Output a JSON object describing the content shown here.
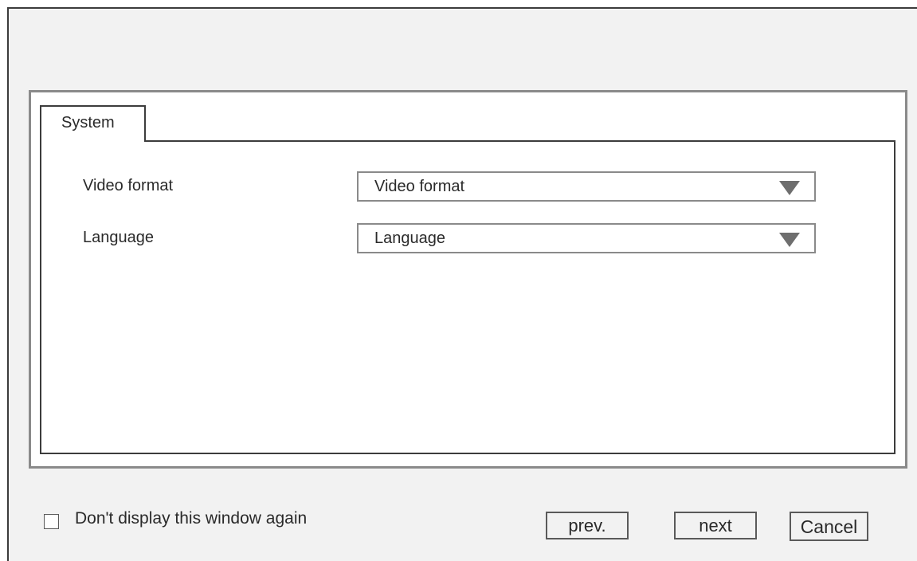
{
  "tabs": [
    {
      "label": "System"
    }
  ],
  "fields": {
    "video_format": {
      "label": "Video format",
      "value": "Video format",
      "icon": "dropdown-triangle-icon"
    },
    "language": {
      "label": "Language",
      "value": "Language",
      "icon": "dropdown-triangle-icon"
    }
  },
  "footer": {
    "dont_show_label": "Don't display this window again",
    "dont_show_checked": false,
    "prev_label": "prev.",
    "next_label": "next",
    "cancel_label": "Cancel"
  }
}
